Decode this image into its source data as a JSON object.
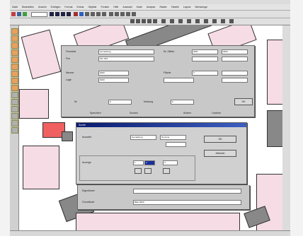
{
  "menu": [
    "Datei",
    "Bearbeiten",
    "Ansicht",
    "Einfügen",
    "Format",
    "Extras",
    "Objekte",
    "Fenster",
    "Hilfe",
    "Auswahl",
    "Karte",
    "Analyse",
    "Raster",
    "Tabelle",
    "Layout",
    "Werkzeuge"
  ],
  "main_dialog": {
    "row1_label": "Flurstück",
    "row1_value": "Gemarkung",
    "row1_right_label": "Nr. Zähler",
    "row1_right_value_1": "0001",
    "row1_right_value_2": "0002",
    "row2_label": "Flur",
    "row2_value": "Flur 003",
    "row3_label": "Nenner",
    "row3_value": "0000",
    "row3_right_label": "Fläche",
    "row3_right_value": "0",
    "row4_label": "Lage",
    "row4_value": "0000",
    "row5_label": "Nr.",
    "row5_value": "0",
    "row5_mid_label": "Nutzung",
    "row5_mid_value": "0",
    "ok_label": "OK",
    "status_items": [
      "Speichern",
      "Suchen",
      "Ändern",
      "Löschen"
    ]
  },
  "sub_dialog": {
    "title": "Suche",
    "label": "Auswahl",
    "field1": "Gemarkung",
    "field2": "Nummer",
    "btn_ok": "OK",
    "btn_cancel": "Abbruch",
    "section_label": "Anzeige",
    "sel_value_1": "1",
    "sel_value_2": "2",
    "sel_value_3": "3"
  },
  "bottom": {
    "label1": "Eigentümer",
    "label2": "Grundbuch",
    "value2": "Blatt 0000"
  }
}
